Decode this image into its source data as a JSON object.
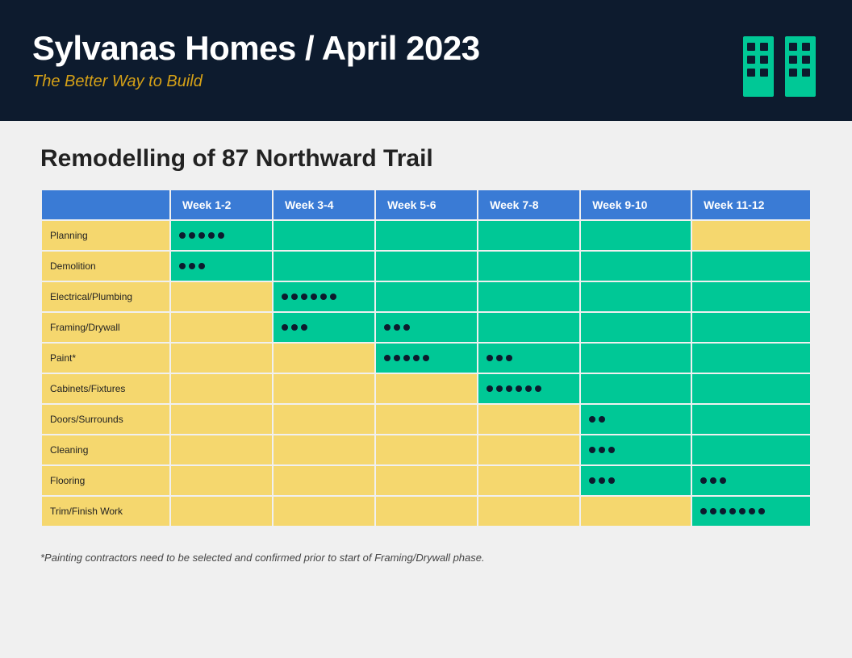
{
  "header": {
    "title": "Sylvanas Homes / April 2023",
    "subtitle": "The Better Way to Build"
  },
  "project": {
    "title": "Remodelling of 87 Northward Trail"
  },
  "table": {
    "columns": [
      "",
      "Week 1-2",
      "Week 3-4",
      "Week 5-6",
      "Week 7-8",
      "Week 9-10",
      "Week 11-12"
    ],
    "rows": [
      {
        "task": "Planning",
        "cells": [
          {
            "type": "dots",
            "count": 5,
            "col": 1
          },
          {
            "type": "teal",
            "col": 2
          },
          {
            "type": "teal",
            "col": 3
          },
          {
            "type": "teal",
            "col": 4
          },
          {
            "type": "teal",
            "col": 5
          },
          {
            "type": "teal",
            "col": 6
          }
        ]
      },
      {
        "task": "Demolition",
        "cells": [
          {
            "type": "dots",
            "count": 3,
            "col": 1
          },
          {
            "type": "teal",
            "col": 2
          },
          {
            "type": "teal",
            "col": 3
          },
          {
            "type": "teal",
            "col": 4
          },
          {
            "type": "teal",
            "col": 5
          },
          {
            "type": "teal",
            "col": 6
          }
        ]
      },
      {
        "task": "Electrical/Plumbing",
        "cells": [
          {
            "type": "yellow",
            "col": 1
          },
          {
            "type": "dots",
            "count": 6,
            "col": 2
          },
          {
            "type": "teal",
            "col": 3
          },
          {
            "type": "teal",
            "col": 4
          },
          {
            "type": "teal",
            "col": 5
          },
          {
            "type": "teal",
            "col": 6
          }
        ]
      },
      {
        "task": "Framing/Drywall",
        "cells": [
          {
            "type": "yellow",
            "col": 1
          },
          {
            "type": "dots_split",
            "count1": 3,
            "count2": 3,
            "col": 2
          },
          {
            "type": "teal",
            "col": 3
          },
          {
            "type": "teal",
            "col": 4
          },
          {
            "type": "teal",
            "col": 5
          },
          {
            "type": "teal",
            "col": 6
          }
        ]
      },
      {
        "task": "Paint*",
        "cells": [
          {
            "type": "yellow",
            "col": 1
          },
          {
            "type": "yellow",
            "col": 2
          },
          {
            "type": "dots_split",
            "count1": 5,
            "count2": 3,
            "col": 3
          },
          {
            "type": "teal",
            "col": 4
          },
          {
            "type": "teal",
            "col": 5
          },
          {
            "type": "teal",
            "col": 6
          }
        ]
      },
      {
        "task": "Cabinets/Fixtures",
        "cells": [
          {
            "type": "yellow",
            "col": 1
          },
          {
            "type": "yellow",
            "col": 2
          },
          {
            "type": "yellow",
            "col": 3
          },
          {
            "type": "dots",
            "count": 6,
            "col": 4
          },
          {
            "type": "teal",
            "col": 5
          },
          {
            "type": "teal",
            "col": 6
          }
        ]
      },
      {
        "task": "Doors/Surrounds",
        "cells": [
          {
            "type": "yellow",
            "col": 1
          },
          {
            "type": "yellow",
            "col": 2
          },
          {
            "type": "yellow",
            "col": 3
          },
          {
            "type": "yellow",
            "col": 4
          },
          {
            "type": "dots",
            "count": 2,
            "col": 5
          },
          {
            "type": "teal",
            "col": 6
          }
        ]
      },
      {
        "task": "Cleaning",
        "cells": [
          {
            "type": "yellow",
            "col": 1
          },
          {
            "type": "yellow",
            "col": 2
          },
          {
            "type": "yellow",
            "col": 3
          },
          {
            "type": "yellow",
            "col": 4
          },
          {
            "type": "dots",
            "count": 3,
            "col": 5
          },
          {
            "type": "teal",
            "col": 6
          }
        ]
      },
      {
        "task": "Flooring",
        "cells": [
          {
            "type": "yellow",
            "col": 1
          },
          {
            "type": "yellow",
            "col": 2
          },
          {
            "type": "yellow",
            "col": 3
          },
          {
            "type": "yellow",
            "col": 4
          },
          {
            "type": "dots_split",
            "count1": 3,
            "count2": 3,
            "col": 5
          },
          {
            "type": "teal",
            "col": 6
          }
        ]
      },
      {
        "task": "Trim/Finish Work",
        "cells": [
          {
            "type": "yellow",
            "col": 1
          },
          {
            "type": "yellow",
            "col": 2
          },
          {
            "type": "yellow",
            "col": 3
          },
          {
            "type": "yellow",
            "col": 4
          },
          {
            "type": "yellow",
            "col": 5
          },
          {
            "type": "dots",
            "count": 7,
            "col": 6
          }
        ]
      }
    ]
  },
  "footnote": "*Painting contractors need to be selected and confirmed prior to start of Framing/Drywall phase."
}
